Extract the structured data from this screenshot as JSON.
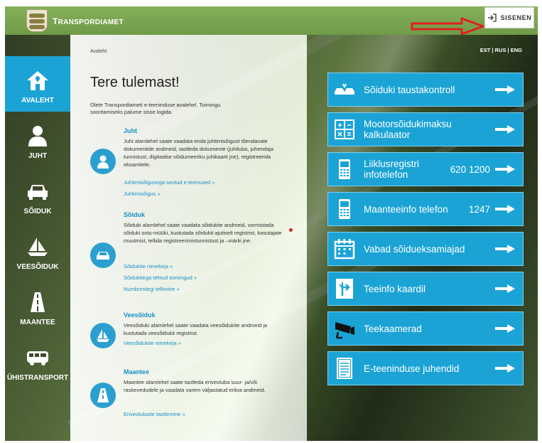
{
  "header": {
    "brand_first": "T",
    "brand_rest": "RANSPORDIAMET",
    "login_label": "SISENEN"
  },
  "nav": [
    {
      "label": "AVALEHT",
      "icon": "home-icon"
    },
    {
      "label": "JUHT",
      "icon": "person-icon"
    },
    {
      "label": "SÕIDUK",
      "icon": "car-icon"
    },
    {
      "label": "VEESÕIDUK",
      "icon": "sailboat-icon"
    },
    {
      "label": "MAANTEE",
      "icon": "road-icon"
    },
    {
      "label": "ÜHISTRANSPORT",
      "icon": "bus-icon"
    }
  ],
  "breadcrumb": "Avaleht",
  "lang": "EST | RUS | ENG",
  "welcome": {
    "title": "Tere tulemast!",
    "intro": "Olete Transpordiameti e-teeninduse avalehel. Toimingu sooritamiseks palume sisse logida."
  },
  "sections": [
    {
      "title": "Juht",
      "text": "Juhi alamlehel saate vaadata enda juhtimisõigust tõendavate dokumentide andmeid, taotleda dokumente (juhiluba, juhendaja tunnistust, digitaalse sõidumeeriku juhikaarti jne), registreerida eksamitele.",
      "links": [
        "Juhtimisõigusega seotud e-teenused »",
        "Juhtimisõigus »"
      ]
    },
    {
      "title": "Sõiduk",
      "text": "Sõiduki alamlehel saate vaadata sõidukite andmeid, vormistada sõiduki ostu-müüki, kustutada sõidukit ajutiselt registrist, kasutajate muutmist, tellida registreerimistunnistust ja –märki jne.",
      "links": [
        "Sõidukite nimekirja »",
        "Sõidukitega tehtud toimingud »",
        "Numbrimärgi tellimine »"
      ]
    },
    {
      "title": "Veesõiduk",
      "text": "Veesõiduki alamlehel saate vaadata veesõidukite andmeid ja kustutada veesõidukit registrist.",
      "links": [
        "Veesõidukite nimekirja »"
      ]
    },
    {
      "title": "Maantee",
      "text": "Maantee alamlehel saate taotleda eriveoluba suur- ja/või raskevedudele ja vaadata varem väljastatud eriloa andmeid.",
      "links": [
        "Eriveolubade taotlemine »"
      ]
    }
  ],
  "tiles": [
    {
      "label": "Sõiduki taustakontroll",
      "num": "",
      "icon": "car-crash-icon"
    },
    {
      "label": "Mootorsõidukimaksu kalkulaator",
      "num": "",
      "icon": "calculator-icon"
    },
    {
      "label": "Liiklusregistri infotelefon",
      "num": "620 1200",
      "icon": "phone-icon"
    },
    {
      "label": "Maanteeinfo telefon",
      "num": "1247",
      "icon": "phone-icon"
    },
    {
      "label": "Vabad sõidueksamiajad",
      "num": "",
      "icon": "calendar-icon"
    },
    {
      "label": "Teeinfo kaardil",
      "num": "",
      "icon": "road-sign-icon"
    },
    {
      "label": "Teekaamerad",
      "num": "",
      "icon": "camera-icon"
    },
    {
      "label": "E-teeninduse juhendid",
      "num": "",
      "icon": "document-icon"
    }
  ],
  "colors": {
    "accent": "#1ba3d6",
    "header": "#7aa64f",
    "annotation": "#e0201c"
  }
}
